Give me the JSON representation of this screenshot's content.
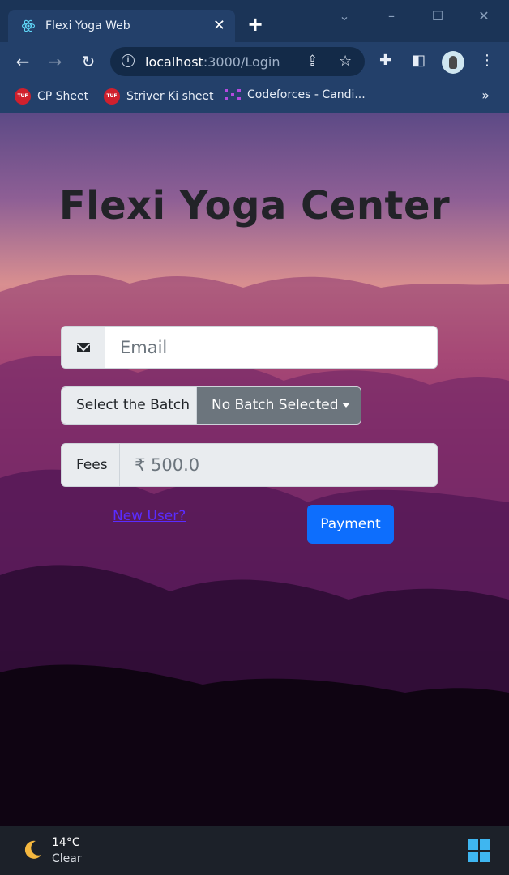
{
  "browser": {
    "tab_title": "Flexi Yoga Web",
    "tab_close": "✕",
    "new_tab": "+",
    "url_host": "localhost",
    "url_path": ":3000/Login",
    "bookmarks": [
      {
        "label": "CP Sheet",
        "icon": "tuf-icon"
      },
      {
        "label": "Striver Ki sheet",
        "icon": "tuf-icon"
      },
      {
        "label": "Codeforces - Candi...",
        "icon": "codeforces-icon"
      }
    ],
    "bookmarks_more": "»",
    "tuf_icon_text": "TUF"
  },
  "page": {
    "title": "Flexi Yoga Center",
    "email_placeholder": "Email",
    "batch_label": "Select the Batch",
    "batch_selected": "No Batch Selected",
    "fees_label": "Fees",
    "fees_value": "₹ 500.0",
    "new_user_link": "New User?",
    "payment_button": "Payment"
  },
  "taskbar": {
    "temperature": "14°C",
    "condition": "Clear"
  },
  "colors": {
    "primary_button": "#0d6efd",
    "dropdown": "#6c757d",
    "link": "#5a2cff"
  }
}
